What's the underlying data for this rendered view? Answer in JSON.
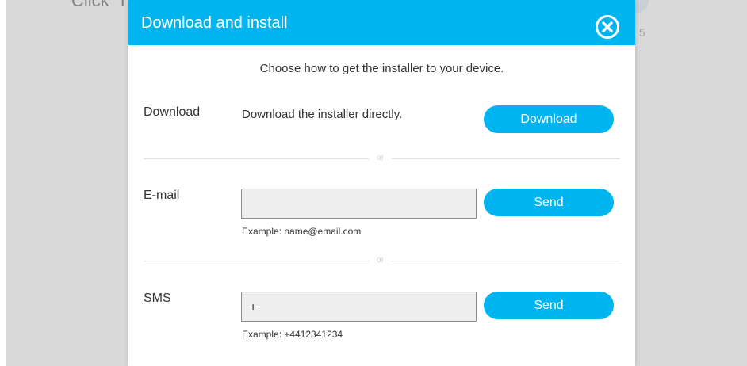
{
  "background": {
    "partial_text": "Click \"I",
    "counter": "5"
  },
  "modal": {
    "title": "Download and install",
    "intro": "Choose how to get the installer to your device.",
    "download": {
      "label": "Download",
      "description": "Download the installer directly.",
      "button_label": "Download"
    },
    "separator_1": "or",
    "email": {
      "label": "E-mail",
      "value": "",
      "hint": "Example: name@email.com",
      "button_label": "Send"
    },
    "separator_2": "or",
    "sms": {
      "label": "SMS",
      "value": "+",
      "hint": "Example: +4412341234",
      "button_label": "Send"
    }
  },
  "colors": {
    "accent": "#00b4f0",
    "overlay": "#d9d9d9",
    "input_bg": "#eeeeee"
  }
}
